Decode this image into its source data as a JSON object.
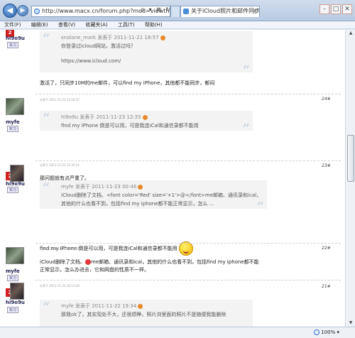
{
  "browser": {
    "address_text": "http://www.macx.cn/forum.php?mod=viewthre",
    "addr_controls": "ρ ▾ ⊠ ↻ ×",
    "tab_title": "关于iCloud照片和邮件同步...",
    "tab_close": "×",
    "window_controls": [
      "–",
      "□",
      "✕"
    ],
    "menu": [
      "文件(F)",
      "编辑(E)",
      "查看(V)",
      "收藏夹(A)",
      "工具(T)",
      "帮助(H)"
    ],
    "zoom": "100%"
  },
  "posts": [
    {
      "user": "hi9o9u",
      "rank": "2",
      "badge": "实习",
      "quote": {
        "author": "snstone_mark",
        "head_suffix": "发表于 2011-11-21 18:57",
        "lines": [
          "你登录过icloud网站，激活过吗？",
          "",
          "https://www.icloud.com/"
        ]
      },
      "text": "激活了，只同步10M的me邮件，可以find my iPhone，其他都不能同步，郁闷"
    },
    {
      "user": "myfe",
      "badge": "实习",
      "meta": "分享于 2011-11-23 14:16:25",
      "floor": "24#",
      "quote": {
        "author": "hi9o9u",
        "head_suffix": "发表于 2011-11-23 12:35",
        "lines": [
          "find my iPhone 倒是可以用，可是我连iCal和通信录都不能用"
        ]
      },
      "text": "那问题就有点严重了。"
    },
    {
      "user": "hi9o9u",
      "rank": "2",
      "badge": "实习",
      "meta": "分享于 2011-11-23 15:35:14",
      "floor": "23#",
      "quote": {
        "author": "myfe",
        "head_suffix": "发表于 2011-11-23 00:46",
        "lines": [
          "iCloud删除了文档、<font color='Red' size='+1'>@</font>me邮箱、通讯录和ical，",
          "其他的什么也看不到，包括find my iphone都不能正常显示，怎么 ..."
        ]
      },
      "text": "find my iPhone 倒是可以用，可是我连iCal和通信录都不能用"
    },
    {
      "user": "myfe",
      "badge": "实习",
      "meta": "分享于 2011-11-23 00:46:12",
      "floor": "22#",
      "text_line1_a": "iCloud删除了文档、",
      "text_line1_b": "me邮箱、通讯录和ical，其他的什么也看不到，包括find my iphone都不能",
      "text_line2": "正常显示，怎么办进去，它和网盘的性质不一样。"
    },
    {
      "user": "hi9o9u",
      "rank": "2",
      "badge": "实习",
      "meta": "分享于 2011-11-22 20:13:28",
      "floor": "21#",
      "quote": {
        "author": "myfe",
        "head_suffix": "发表于 2011-11-22 19:34",
        "lines": [
          "那我ok了，其实现处不大，还很烦睁，照片浏里面的照片不是随便我能删除"
        ]
      }
    }
  ]
}
